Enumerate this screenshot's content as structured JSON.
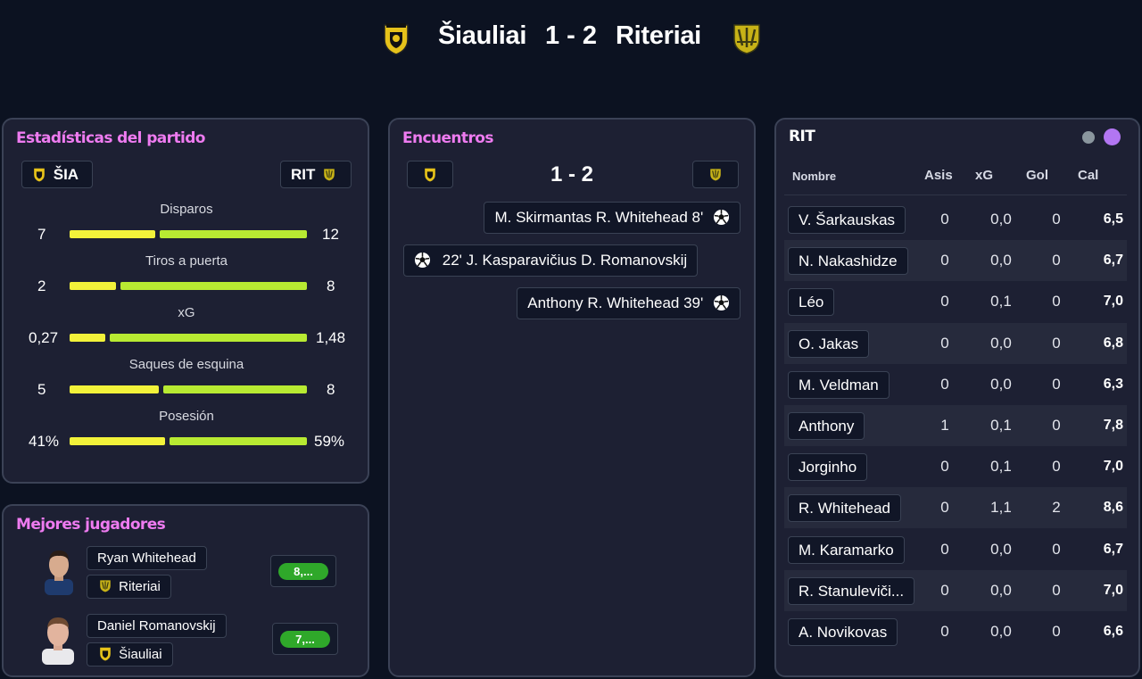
{
  "header": {
    "home_team": "Šiauliai",
    "score": "1 - 2",
    "away_team": "Riteriai"
  },
  "stats_panel": {
    "title": "Estadísticas del partido",
    "home_abbr": "ŠIA",
    "away_abbr": "RIT",
    "stats": [
      {
        "label": "Disparos",
        "home": "7",
        "away": "12",
        "home_share": 0.368
      },
      {
        "label": "Tiros a puerta",
        "home": "2",
        "away": "8",
        "home_share": 0.2
      },
      {
        "label": "xG",
        "home": "0,27",
        "away": "1,48",
        "home_share": 0.154
      },
      {
        "label": "Saques de esquina",
        "home": "5",
        "away": "8",
        "home_share": 0.385
      },
      {
        "label": "Posesión",
        "home": "41%",
        "away": "59%",
        "home_share": 0.41
      }
    ]
  },
  "best_players": {
    "title": "Mejores jugadores",
    "players": [
      {
        "name": "Ryan Whitehead",
        "team": "Riteriai",
        "rating": "8,..."
      },
      {
        "name": "Daniel Romanovskij",
        "team": "Šiauliai",
        "rating": "7,..."
      }
    ]
  },
  "encounters": {
    "title": "Encuentros",
    "score": "1 - 2",
    "events": [
      {
        "text": "M. Skirmantas R. Whitehead 8'",
        "side": "away"
      },
      {
        "text": "22' J. Kasparavičius D. Romanovskij",
        "side": "home"
      },
      {
        "text": "Anthony R. Whitehead 39'",
        "side": "away"
      }
    ]
  },
  "player_table": {
    "team": "RIT",
    "columns": [
      "Nombre",
      "Asis",
      "xG",
      "Gol",
      "Cal"
    ],
    "rows": [
      {
        "name": "V. Šarkauskas",
        "asis": "0",
        "xg": "0,0",
        "gol": "0",
        "cal": "6,5"
      },
      {
        "name": "N. Nakashidze",
        "asis": "0",
        "xg": "0,0",
        "gol": "0",
        "cal": "6,7"
      },
      {
        "name": "Léo",
        "asis": "0",
        "xg": "0,1",
        "gol": "0",
        "cal": "7,0"
      },
      {
        "name": "O. Jakas",
        "asis": "0",
        "xg": "0,0",
        "gol": "0",
        "cal": "6,8"
      },
      {
        "name": "M. Veldman",
        "asis": "0",
        "xg": "0,0",
        "gol": "0",
        "cal": "6,3"
      },
      {
        "name": "Anthony",
        "asis": "1",
        "xg": "0,1",
        "gol": "0",
        "cal": "7,8"
      },
      {
        "name": "Jorginho",
        "asis": "0",
        "xg": "0,1",
        "gol": "0",
        "cal": "7,0"
      },
      {
        "name": "R. Whitehead",
        "asis": "0",
        "xg": "1,1",
        "gol": "2",
        "cal": "8,6"
      },
      {
        "name": "M. Karamarko",
        "asis": "0",
        "xg": "0,0",
        "gol": "0",
        "cal": "6,7"
      },
      {
        "name": "R. Stanuleviči...",
        "asis": "0",
        "xg": "0,0",
        "gol": "0",
        "cal": "7,0"
      },
      {
        "name": "A. Novikovas",
        "asis": "0",
        "xg": "0,0",
        "gol": "0",
        "cal": "6,6"
      }
    ],
    "toggle_colors": {
      "inactive": "#8a969e",
      "active": "#b276f2"
    }
  },
  "colors": {
    "background": "#0c1221",
    "panel": "#1d2033",
    "title_accent": "#ee7bf0",
    "home_bar": "#f2f23a",
    "away_bar": "#b8ea32",
    "rating_green": "#2fa82a"
  },
  "icons": {
    "home_crest": "siauliai-crest-icon",
    "away_crest": "riteriai-crest-icon",
    "goal": "soccer-ball-icon"
  }
}
